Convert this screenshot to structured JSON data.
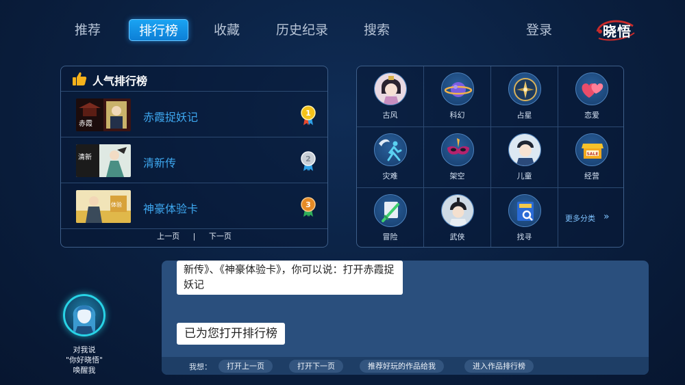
{
  "nav": {
    "items": [
      {
        "label": "推荐"
      },
      {
        "label": "排行榜",
        "active": true
      },
      {
        "label": "收藏"
      },
      {
        "label": "历史纪录"
      },
      {
        "label": "搜索"
      }
    ],
    "login": "登录",
    "logo_text": "晓悟"
  },
  "ranking": {
    "title": "人气排行榜",
    "rows": [
      {
        "name": "赤霞捉妖记",
        "rank": "1",
        "medal": "gold"
      },
      {
        "name": "清新传",
        "rank": "2",
        "medal": "silver"
      },
      {
        "name": "神豪体验卡",
        "rank": "3",
        "medal": "bronze"
      }
    ],
    "prev": "上一页",
    "separator": "|",
    "next": "下一页"
  },
  "categories": {
    "items": [
      {
        "label": "古风",
        "icon": "ancient-girl-icon"
      },
      {
        "label": "科幻",
        "icon": "planet-icon"
      },
      {
        "label": "占星",
        "icon": "compass-icon"
      },
      {
        "label": "恋爱",
        "icon": "hearts-icon"
      },
      {
        "label": "灾难",
        "icon": "running-person-icon"
      },
      {
        "label": "架空",
        "icon": "mask-icon"
      },
      {
        "label": "儿童",
        "icon": "child-icon"
      },
      {
        "label": "经营",
        "icon": "shop-icon"
      },
      {
        "label": "冒险",
        "icon": "sword-icon"
      },
      {
        "label": "武侠",
        "icon": "swordsman-icon"
      },
      {
        "label": "找寻",
        "icon": "magnifier-book-icon"
      }
    ],
    "more": "更多分类",
    "more_arrow": "»"
  },
  "assistant": {
    "hint_line1": "对我说",
    "hint_line2": "\"你好晓悟\"",
    "hint_line3": "唤醒我",
    "bubble_top": "新传》、《神豪体验卡》，你可以说：打开赤霞捉妖记",
    "bubble_bottom": "已为您打开排行榜",
    "wish_label": "我想：",
    "chips": [
      "打开上一页",
      "打开下一页",
      "推荐好玩的作品给我",
      "进入作品排行榜"
    ]
  },
  "colors": {
    "accent": "#1aa3f2",
    "link": "#3ea8f0",
    "panel_border": "#3e5f8a",
    "chat_panel": "#2a4f7d"
  }
}
